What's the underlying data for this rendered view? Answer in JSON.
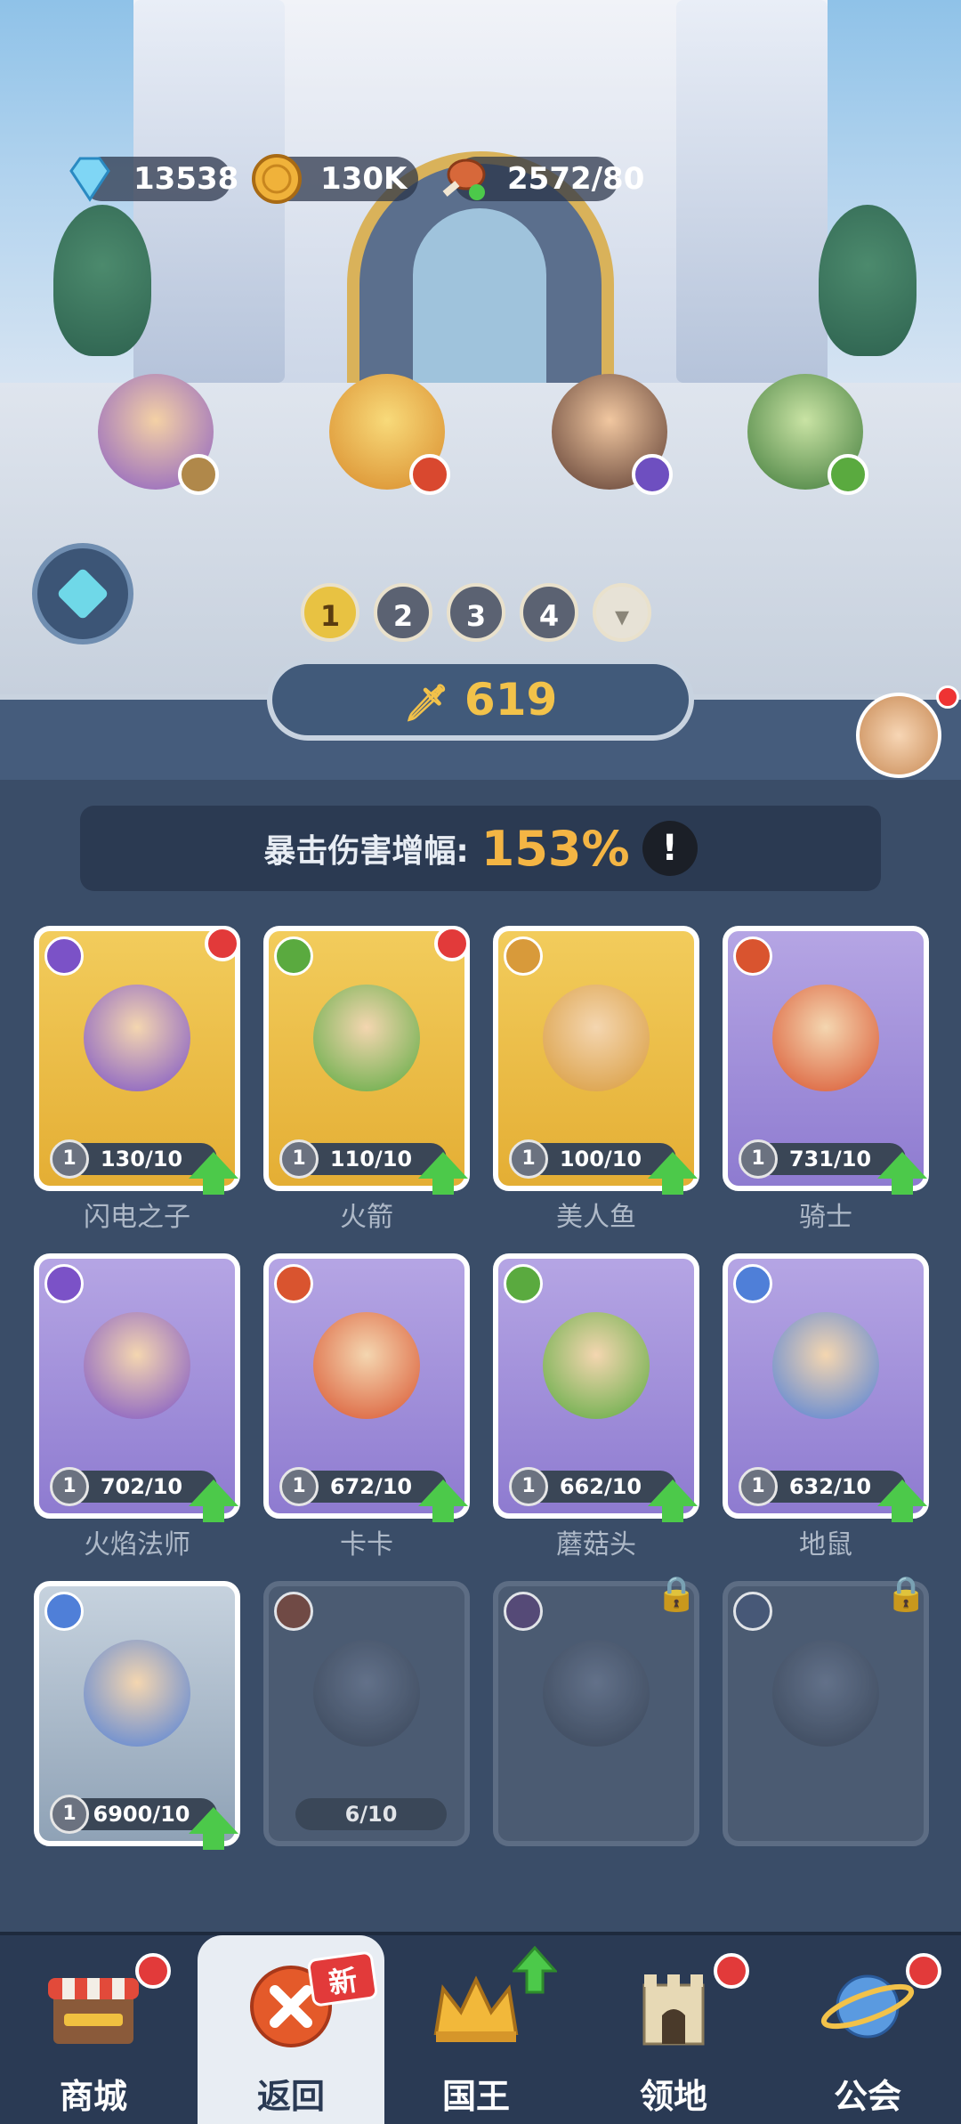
{
  "resources": {
    "gems": "13538",
    "gold": "130K",
    "food": "2572/80"
  },
  "heroes_top": [
    {
      "class": "staff",
      "color": "#7d5bc7"
    },
    {
      "class": "sword",
      "color": "#d9482f"
    },
    {
      "class": "staff",
      "color": "#6e4fc0"
    },
    {
      "class": "bow",
      "color": "#5aaa3f"
    }
  ],
  "page_tabs": [
    "1",
    "2",
    "3",
    "4"
  ],
  "active_tab": "1",
  "power": "619",
  "crit_label": "暴击伤害增幅:",
  "crit_value": "153%",
  "info_mark": "!",
  "cards": [
    {
      "name": "闪电之子",
      "level": "1",
      "progress": "130/10",
      "rarity": "gold",
      "class_color": "#7b52c7",
      "reddot": true,
      "upgrade": true
    },
    {
      "name": "火箭",
      "level": "1",
      "progress": "110/10",
      "rarity": "gold",
      "class_color": "#5aaa3f",
      "reddot": true,
      "upgrade": true
    },
    {
      "name": "美人鱼",
      "level": "1",
      "progress": "100/10",
      "rarity": "gold",
      "class_color": "#d89a3a",
      "reddot": false,
      "upgrade": true
    },
    {
      "name": "骑士",
      "level": "1",
      "progress": "731/10",
      "rarity": "purple",
      "class_color": "#d9542f",
      "reddot": false,
      "upgrade": true
    },
    {
      "name": "火焰法师",
      "level": "1",
      "progress": "702/10",
      "rarity": "purple",
      "class_color": "#7b52c7",
      "reddot": false,
      "upgrade": true
    },
    {
      "name": "卡卡",
      "level": "1",
      "progress": "672/10",
      "rarity": "purple",
      "class_color": "#d9542f",
      "reddot": false,
      "upgrade": true
    },
    {
      "name": "蘑菇头",
      "level": "1",
      "progress": "662/10",
      "rarity": "purple",
      "class_color": "#5aaa3f",
      "reddot": false,
      "upgrade": true
    },
    {
      "name": "地鼠",
      "level": "1",
      "progress": "632/10",
      "rarity": "purple",
      "class_color": "#4f7fd8",
      "reddot": false,
      "upgrade": true
    },
    {
      "name": "",
      "level": "1",
      "progress": "6900/10",
      "rarity": "grey",
      "class_color": "#4f7fd8",
      "reddot": false,
      "upgrade": true
    },
    {
      "name": "",
      "level": "",
      "progress": "6/10",
      "rarity": "locked",
      "class_color": "#7a4a40",
      "reddot": false,
      "upgrade": false
    },
    {
      "name": "",
      "level": "",
      "progress": "",
      "rarity": "locked",
      "class_color": "#5a4a7a",
      "reddot": false,
      "upgrade": false,
      "lock": true
    },
    {
      "name": "",
      "level": "",
      "progress": "",
      "rarity": "locked",
      "class_color": "#4a5a7a",
      "reddot": false,
      "upgrade": false,
      "lock": true
    }
  ],
  "nav": [
    {
      "label": "商城",
      "icon": "shop-icon",
      "dot": true
    },
    {
      "label": "返回",
      "icon": "close-icon",
      "active": true,
      "tag": "新"
    },
    {
      "label": "国王",
      "icon": "crown-icon",
      "arrow": true
    },
    {
      "label": "领地",
      "icon": "castle-icon",
      "dot": true
    },
    {
      "label": "公会",
      "icon": "planet-icon",
      "dot": true
    }
  ]
}
